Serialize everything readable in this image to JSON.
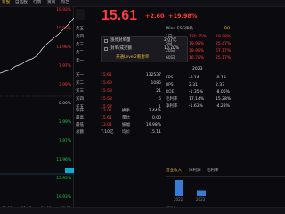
{
  "topnav": [
    "新股",
    "自选股",
    "行情",
    "资讯",
    "综合",
    "期货",
    "全球",
    "基金"
  ],
  "chart": {
    "pct_labels": [
      "19.93%",
      "15.95%",
      "11.96%",
      "7.97%",
      "3.99%",
      "0.00%",
      "3.99%",
      "7.97%",
      "11.96%",
      "15.95%",
      "19.93%"
    ],
    "x_labels": [
      "09:30",
      "11:30",
      "14:00",
      "15:00"
    ],
    "side_label": "15:00"
  },
  "quote": {
    "price": "15.61",
    "change": "+2.60",
    "change_pct": "+19.98%",
    "tags": [
      "涨停",
      "换手",
      "量比",
      "成交量"
    ]
  },
  "book": {
    "sell": [
      {
        "label": "卖五",
        "price": "",
        "vol": ""
      },
      {
        "label": "卖四",
        "price": "",
        "vol": ""
      },
      {
        "label": "卖三",
        "price": "",
        "vol": ""
      },
      {
        "label": "卖二",
        "price": "",
        "vol": ""
      },
      {
        "label": "卖一",
        "price": "",
        "vol": ""
      }
    ],
    "buy": [
      {
        "label": "买一",
        "price": "15.61",
        "vol": "132537"
      },
      {
        "label": "买二",
        "price": "15.60",
        "vol": "1085"
      },
      {
        "label": "买三",
        "price": "15.59",
        "vol": "21"
      },
      {
        "label": "买四",
        "price": "15.58",
        "vol": "5"
      },
      {
        "label": "买五",
        "price": "15.57",
        "vol": "1"
      }
    ]
  },
  "popup": {
    "item1_label": "涨停封单量",
    "item1_value": "2.07亿",
    "item2_label": "封单/成交额",
    "item2_value": "10.70%",
    "link": "开通Level2看封单"
  },
  "metrics": [
    {
      "l": "今开",
      "v": "13.01",
      "l2": "换手",
      "v2": "2.44%"
    },
    {
      "l": "最高",
      "v": "15.61",
      "l2": "量比",
      "v2": "0.00"
    },
    {
      "l": "最低",
      "v": "13.01",
      "l2": "振幅",
      "v2": "19.98%"
    },
    {
      "l": "总额",
      "v": "7.10亿",
      "l2": "均价",
      "v2": "15.11"
    }
  ],
  "right": {
    "header": "Wind ESG评级",
    "rating": "BB",
    "rows": [
      {
        "l": "1日",
        "v": "130.35%",
        "v2": "19.98%"
      },
      {
        "l": "5日",
        "v": "19.98%",
        "v2": "25.47%"
      },
      {
        "l": "20日",
        "v": "19.98%",
        "v2": "67.17%"
      },
      {
        "l": "60日",
        "v": "16.78%",
        "v2": "25.17%"
      }
    ],
    "fin_year": "2023",
    "fin_rows": [
      {
        "l": "EPS",
        "v": "-0.14",
        "v2": "-0.19"
      },
      {
        "l": "BPS",
        "v": "2.31",
        "v2": "2.33"
      },
      {
        "l": "ROE",
        "v": "-1.35%",
        "v2": "-8.06%"
      },
      {
        "l": "毛利率",
        "v": "17.14%",
        "v2": "15.28%"
      },
      {
        "l": "净利率",
        "v": "-1.63%",
        "v2": "-4.28%"
      }
    ]
  },
  "tabs": [
    "营业收入",
    "净利润",
    "毛利率"
  ],
  "bars": {
    "years": [
      "2022",
      "2023"
    ],
    "values": [
      18.0,
      6.5
    ]
  },
  "unit": "(CNY)"
}
